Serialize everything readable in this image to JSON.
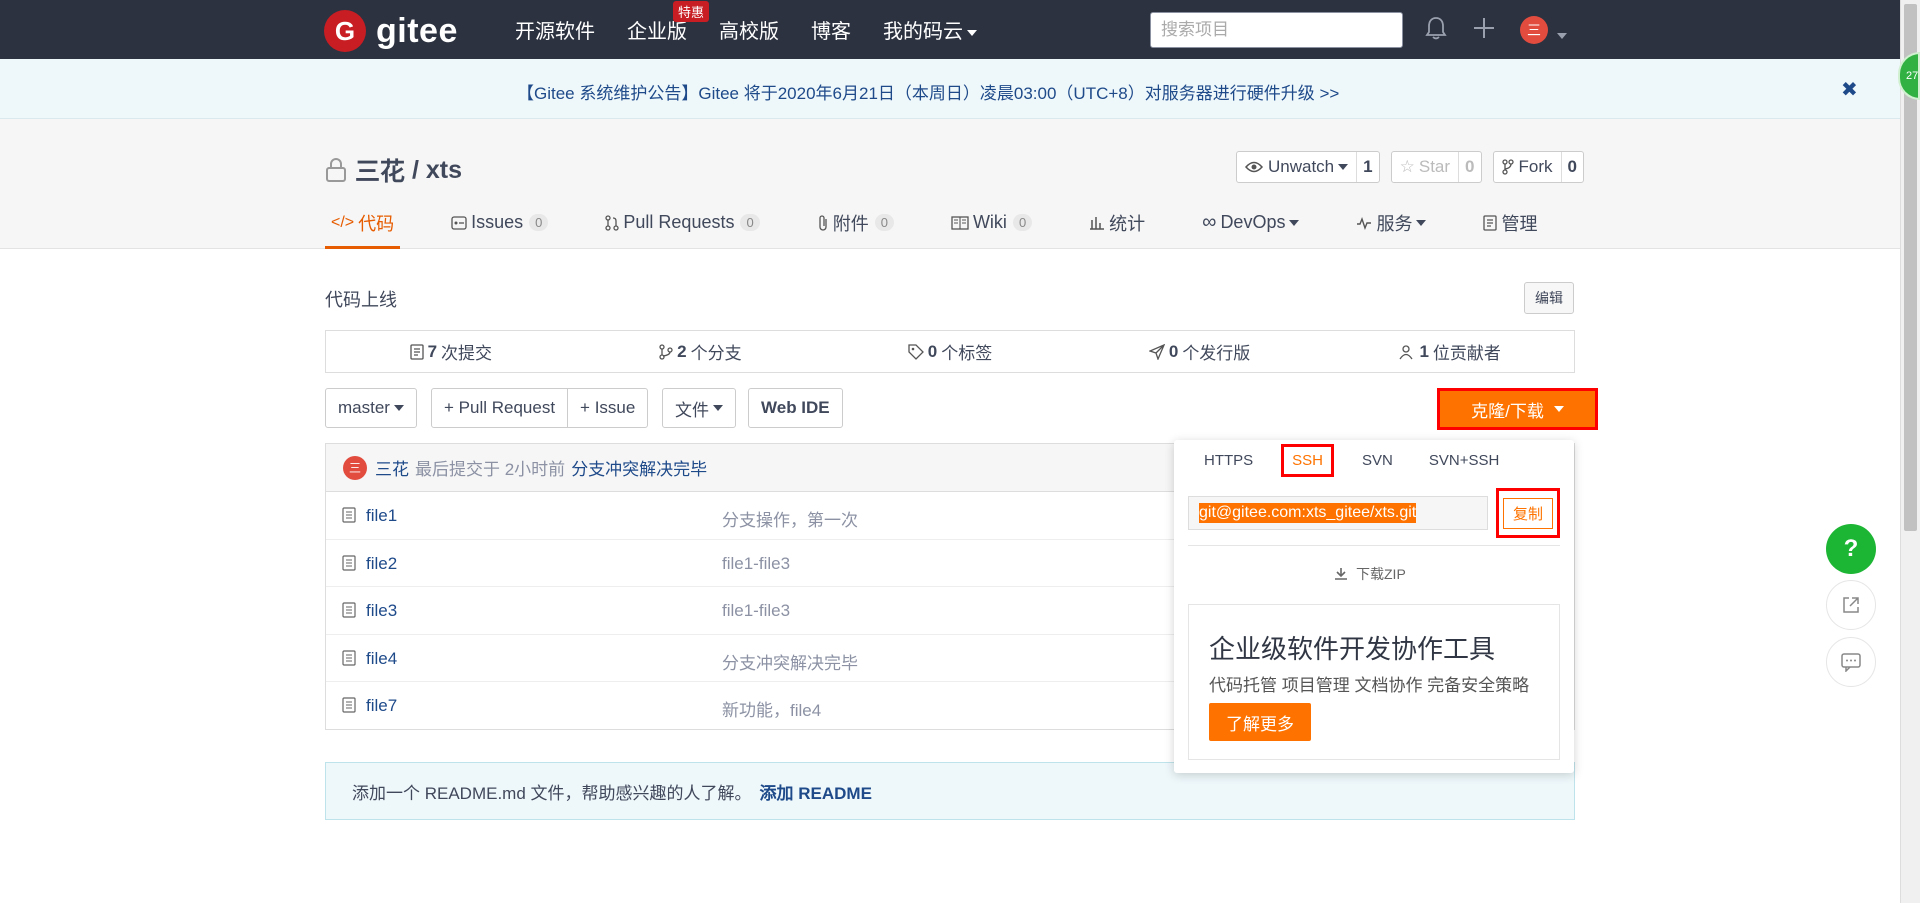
{
  "navbar": {
    "logo_mark": "G",
    "logo_text": "gitee",
    "items": [
      {
        "label": "开源软件"
      },
      {
        "label": "企业版",
        "badge": "特惠"
      },
      {
        "label": "高校版"
      },
      {
        "label": "博客"
      },
      {
        "label": "我的码云"
      }
    ],
    "search_placeholder": "搜索项目",
    "avatar_text": "三"
  },
  "notice": {
    "text": "【Gitee 系统维护公告】Gitee 将于2020年6月21日（本周日）凌晨03:00（UTC+8）对服务器进行硬件升级 >>",
    "close": "✖"
  },
  "repo": {
    "owner": "三花",
    "separator": " / ",
    "name": "xts",
    "actions": {
      "watch_label": "Unwatch",
      "watch_count": "1",
      "star_label": "Star",
      "star_count": "0",
      "fork_label": "Fork",
      "fork_count": "0"
    },
    "tabs": [
      {
        "label": "代码",
        "icon": "</>"
      },
      {
        "label": "Issues",
        "count": "0"
      },
      {
        "label": "Pull Requests",
        "count": "0"
      },
      {
        "label": "附件",
        "count": "0"
      },
      {
        "label": "Wiki",
        "count": "0"
      },
      {
        "label": "统计"
      },
      {
        "label": "DevOps"
      },
      {
        "label": "服务"
      },
      {
        "label": "管理"
      }
    ]
  },
  "main": {
    "description": "代码上线",
    "edit_label": "编辑",
    "stats": [
      {
        "count": "7",
        "label": "次提交"
      },
      {
        "count": "2",
        "label": "个分支"
      },
      {
        "count": "0",
        "label": "个标签"
      },
      {
        "count": "0",
        "label": "个发行版"
      },
      {
        "count": "1",
        "label": "位贡献者"
      }
    ],
    "branch": "master",
    "pull_request_label": "+ Pull Request",
    "issue_label": "+ Issue",
    "file_label": "文件",
    "webide_label": "Web IDE",
    "clone_label": "克隆/下载",
    "last_commit": {
      "avatar": "三",
      "author": "三花",
      "meta": "最后提交于 2小时前",
      "message": "分支冲突解决完毕"
    },
    "files": [
      {
        "name": "file1",
        "message": "分支操作，第一次"
      },
      {
        "name": "file2",
        "message": "file1-file3"
      },
      {
        "name": "file3",
        "message": "file1-file3"
      },
      {
        "name": "file4",
        "message": "分支冲突解决完毕"
      },
      {
        "name": "file7",
        "message": "新功能，file4"
      }
    ],
    "readme": {
      "text": "添加一个 README.md 文件，帮助感兴趣的人了解。",
      "link": "添加 README"
    }
  },
  "clone_dropdown": {
    "tabs": [
      "HTTPS",
      "SSH",
      "SVN",
      "SVN+SSH"
    ],
    "active_tab": "SSH",
    "url": "git@gitee.com:xts_gitee/xts.git",
    "copy_label": "复制",
    "download_zip": "下载ZIP",
    "promo_title": "企业级软件开发协作工具",
    "promo_subtitle": "代码托管 项目管理 文档协作 完备安全策略",
    "promo_button": "了解更多"
  },
  "floating": {
    "help": "?",
    "badge": "27"
  },
  "colors": {
    "navbar_bg": "#2c3240",
    "accent_orange": "#fe7300",
    "brand_red": "#c71d23",
    "link_blue": "#1e4a8a",
    "highlight_red": "#ff0000"
  }
}
